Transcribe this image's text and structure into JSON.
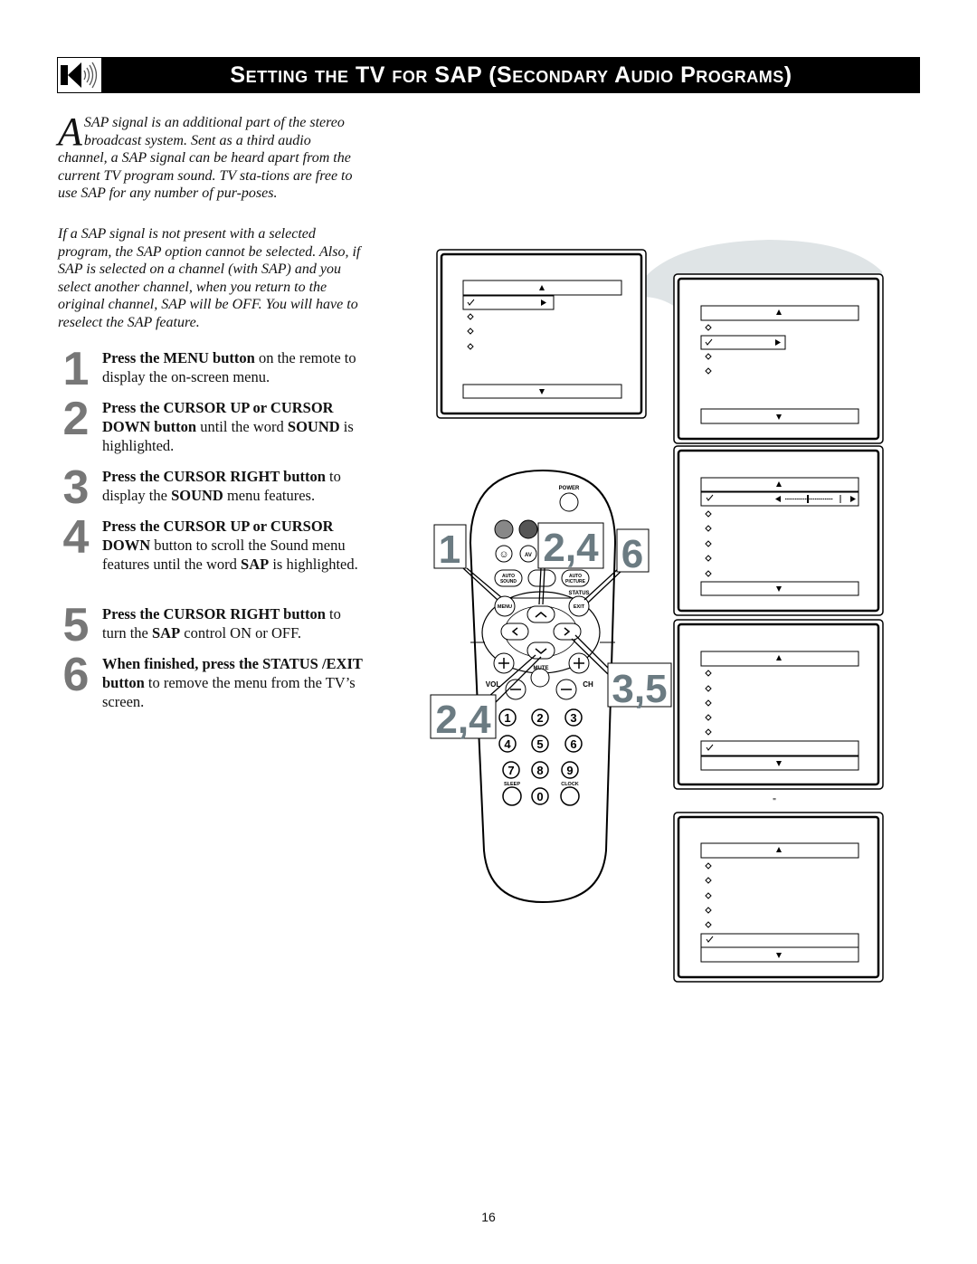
{
  "header": {
    "title": "Setting the TV for SAP (Secondary Audio Programs)",
    "icon": "speaker-sound-icon"
  },
  "intro": {
    "dropcap": "A",
    "p1": "SAP signal is an additional part of the stereo broadcast system.  Sent as a third audio channel, a SAP signal can be heard apart from the current TV program sound.  TV sta-tions are free to use SAP for any number of pur-poses.",
    "p2": "If a SAP signal is not present with a selected program, the SAP option cannot be selected. Also, if SAP is selected on a channel (with SAP) and you select another channel, when you return to the original channel, SAP will be OFF. You will have to reselect the SAP feature."
  },
  "steps": [
    {
      "num": "1",
      "parts": [
        {
          "b": true,
          "t": "Press the MENU button"
        },
        {
          "b": false,
          "t": " on the remote to display the on-screen menu."
        }
      ]
    },
    {
      "num": "2",
      "parts": [
        {
          "b": true,
          "t": "Press the CURSOR UP or CURSOR DOWN button"
        },
        {
          "b": false,
          "t": " until the word "
        },
        {
          "b": true,
          "t": "SOUND"
        },
        {
          "b": false,
          "t": " is highlighted."
        }
      ]
    },
    {
      "num": "3",
      "parts": [
        {
          "b": true,
          "t": "Press the CURSOR RIGHT button"
        },
        {
          "b": false,
          "t": " to display the "
        },
        {
          "b": true,
          "t": "SOUND"
        },
        {
          "b": false,
          "t": " menu features."
        }
      ]
    },
    {
      "num": "4",
      "parts": [
        {
          "b": true,
          "t": "Press the CURSOR UP or  CURSOR DOWN"
        },
        {
          "b": false,
          "t": " button to scroll the Sound menu features until the word "
        },
        {
          "b": true,
          "t": "SAP"
        },
        {
          "b": false,
          "t": " is highlighted."
        }
      ]
    },
    {
      "num": "5",
      "parts": [
        {
          "b": true,
          "t": "Press the CURSOR RIGHT button"
        },
        {
          "b": false,
          "t": " to turn the "
        },
        {
          "b": true,
          "t": "SAP"
        },
        {
          "b": false,
          "t": " control ON or OFF."
        }
      ]
    },
    {
      "num": "6",
      "parts": [
        {
          "b": true,
          "t": "When finished, press the STATUS /EXIT button"
        },
        {
          "b": false,
          "t": " to remove the menu from the TV’s screen."
        }
      ]
    }
  ],
  "remote": {
    "power": "POWER",
    "av": "AV",
    "auto_sound": [
      "AUTO",
      "SOUND"
    ],
    "auto_picture": [
      "AUTO",
      "PICTURE"
    ],
    "status": "STATUS",
    "menu": "MENU",
    "exit": "EXIT",
    "mute": "MUTE",
    "vol": "VOL",
    "ch": "CH",
    "sleep": "SLEEP",
    "clock": "CLOCK",
    "digits": [
      "1",
      "2",
      "3",
      "4",
      "5",
      "6",
      "7",
      "8",
      "9",
      "0"
    ]
  },
  "callouts": {
    "c1": "1",
    "c24a": "2,4",
    "c6": "6",
    "c35": "3,5",
    "c24b": "2,4",
    "color": "#6b7b82"
  },
  "stray_mark": "\"",
  "page_number": "16"
}
